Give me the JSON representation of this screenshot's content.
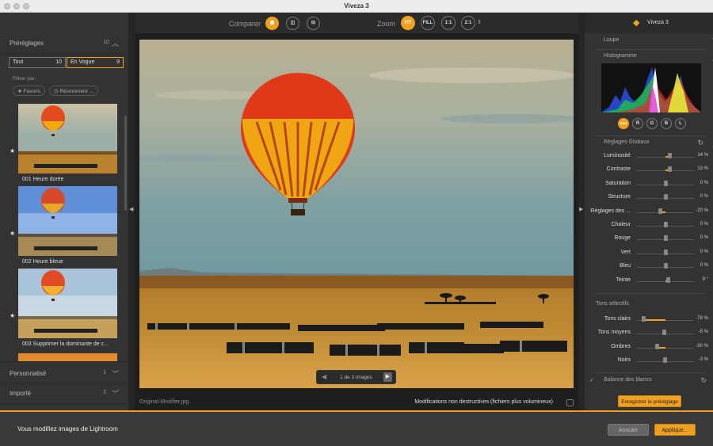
{
  "window": {
    "title": "Viveza 3"
  },
  "presets": {
    "header": "Préréglages",
    "count": "10",
    "tabs": [
      {
        "label": "Tout",
        "count": "10"
      },
      {
        "label": "En Vogue",
        "count": "9"
      }
    ],
    "filter_label": "Filtrer par :",
    "filters": [
      {
        "label": "Favoris"
      },
      {
        "label": "Récemment ..."
      }
    ],
    "items": [
      {
        "label": "001 Heure dorée"
      },
      {
        "label": "002 Heure bleue"
      },
      {
        "label": "003 Supprimer la dominante de c..."
      }
    ],
    "custom": {
      "label": "Personnalisé",
      "count": "1"
    },
    "imported": {
      "label": "Importé",
      "count": "2"
    }
  },
  "toolbar": {
    "compare_label": "Comparer",
    "zoom_label": "Zoom",
    "zoom_options": [
      "FIT",
      "FILL",
      "1:1",
      "2:1"
    ]
  },
  "viewer": {
    "pager": "1 de 3 images",
    "filename": "Original-Modifier.jpg",
    "nondestructive_label": "Modifications non destructives (fichiers plus volumineux)"
  },
  "panel": {
    "brand": "Viveza 3",
    "loupe": "Loupe",
    "histogram": "Histogramme",
    "channels": [
      "RGB",
      "R",
      "G",
      "B",
      "L"
    ],
    "global_title": "Réglages Globaux",
    "global": [
      {
        "name": "Luminosité",
        "value": "14 %",
        "v": 14
      },
      {
        "name": "Contraste",
        "value": "13 %",
        "v": 13
      },
      {
        "name": "Saturation",
        "value": "0 %",
        "v": 0
      },
      {
        "name": "Structure",
        "value": "0 %",
        "v": 0
      },
      {
        "name": "Réglages des ...",
        "value": "-20 %",
        "v": -20
      },
      {
        "name": "Chaleur",
        "value": "0 %",
        "v": 0
      },
      {
        "name": "Rouge",
        "value": "0 %",
        "v": 0
      },
      {
        "name": "Vert",
        "value": "0 %",
        "v": 0
      },
      {
        "name": "Bleu",
        "value": "0 %",
        "v": 0
      },
      {
        "name": "Teinte",
        "value": "9 °",
        "v": 9
      }
    ],
    "tones_title": "Tons sélectifs",
    "tones": [
      {
        "name": "Tons clairs",
        "value": "-78 %",
        "v": -78
      },
      {
        "name": "Tons moyens",
        "value": "-5 %",
        "v": -5
      },
      {
        "name": "Ombres",
        "value": "-30 %",
        "v": -30
      },
      {
        "name": "Noirs",
        "value": "-3 %",
        "v": -3
      }
    ],
    "white_balance": "Balance des blancs",
    "save_preset": "Enregistrer le préréglage"
  },
  "footer": {
    "message": "Vous modifiez images de Lightroom",
    "cancel": "Annuler",
    "apply": "Applique..."
  },
  "colors": {
    "accent": "#f0a020"
  }
}
